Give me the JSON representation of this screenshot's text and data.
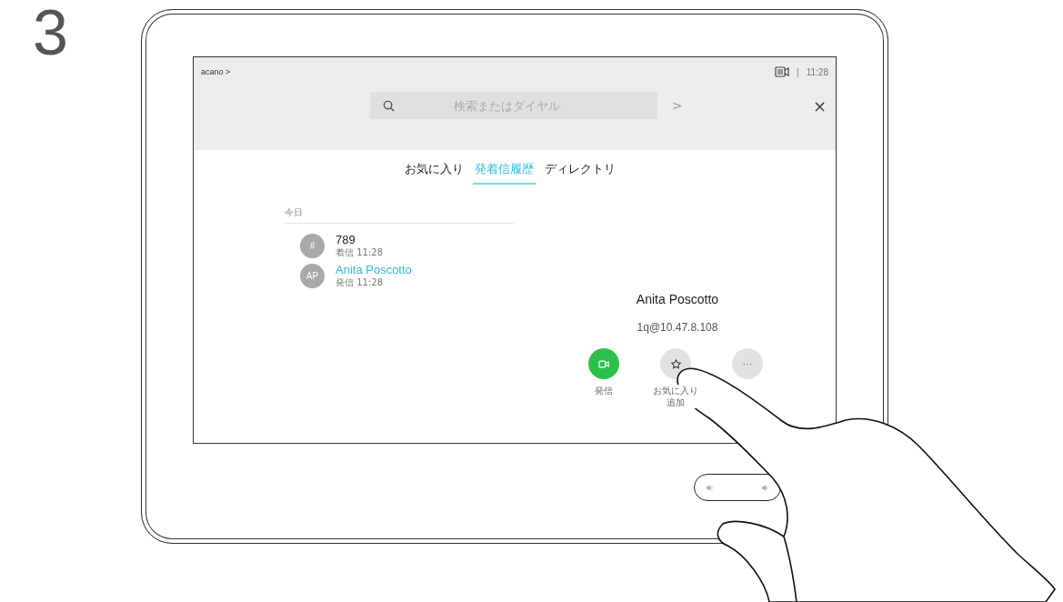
{
  "step": "3",
  "status": {
    "breadcrumb": "acano >",
    "separator": "|",
    "time": "11:28"
  },
  "search": {
    "placeholder": "検索またはダイヤル",
    "go": ">",
    "close": "×"
  },
  "tabs": [
    {
      "label": "お気に入り",
      "selected": false
    },
    {
      "label": "発着信履歴",
      "selected": true
    },
    {
      "label": "ディレクトリ",
      "selected": false
    }
  ],
  "list": {
    "heading": "今日",
    "items": [
      {
        "initials": "#",
        "title": "789",
        "subtitle": "着信 11:28",
        "selected": false
      },
      {
        "initials": "AP",
        "title": "Anita Poscotto",
        "subtitle": "発信 11:28",
        "selected": true
      }
    ]
  },
  "detail": {
    "name": "Anita Poscotto",
    "address": "1q@10.47.8.108",
    "actions": [
      {
        "kind": "call",
        "label": [
          "発信"
        ]
      },
      {
        "kind": "favorite",
        "label": [
          "お気に入り",
          "追加"
        ]
      },
      {
        "kind": "more"
      }
    ]
  }
}
